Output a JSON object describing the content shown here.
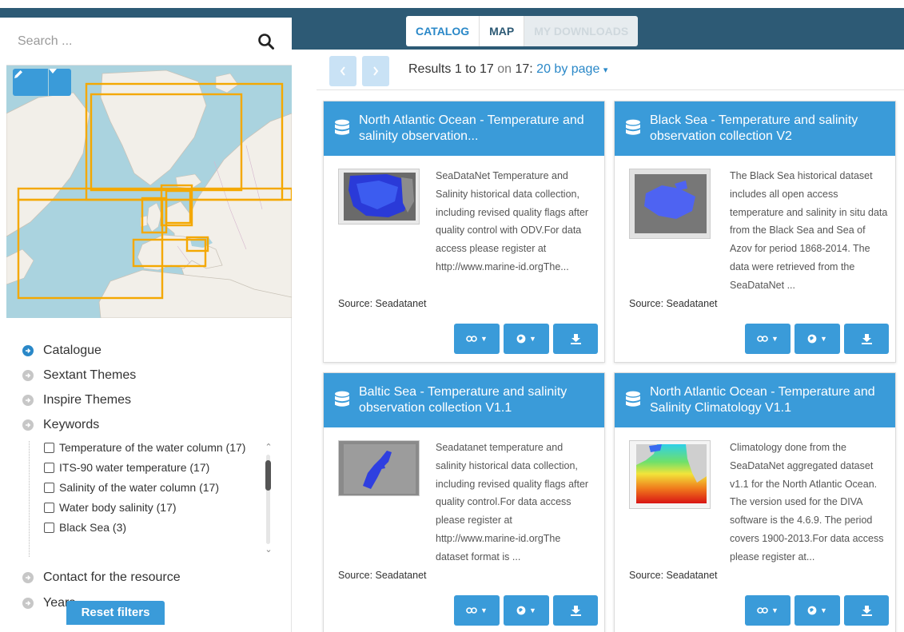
{
  "tabs": [
    {
      "label": "CATALOG"
    },
    {
      "label": "MAP"
    },
    {
      "label": "MY DOWNLOADS"
    }
  ],
  "search": {
    "placeholder": "Search ..."
  },
  "facets": {
    "items": [
      {
        "label": "Catalogue",
        "active": true
      },
      {
        "label": "Sextant Themes",
        "active": false
      },
      {
        "label": "Inspire Themes",
        "active": false
      },
      {
        "label": "Keywords",
        "active": false
      },
      {
        "label": "Contact for the resource",
        "active": false
      },
      {
        "label": "Years",
        "active": false
      }
    ],
    "keywords": [
      {
        "label": "Temperature of the water column (17)"
      },
      {
        "label": "ITS-90 water temperature (17)"
      },
      {
        "label": "Salinity of the water column (17)"
      },
      {
        "label": "Water body salinity (17)"
      },
      {
        "label": "Black Sea (3)"
      }
    ],
    "reset_label": "Reset filters"
  },
  "results": {
    "prefix": "Results",
    "from": "1",
    "to_word": "to",
    "to": "17",
    "on_word": "on",
    "total": "17",
    "sep": ":",
    "per_page": "20 by page"
  },
  "cards": [
    {
      "title": "North Atlantic Ocean - Temperature and salinity observation...",
      "abstract": "SeaDataNet Temperature and Salinity historical data collection, including revised quality flags after quality control with ODV.For data access please register at http://www.marine-id.orgThe...",
      "source": "Source: Seadatanet"
    },
    {
      "title": "Black Sea - Temperature and salinity observation collection V2",
      "abstract": "The Black Sea historical dataset includes all open access temperature and salinity in situ data from the Black Sea and Sea of Azov for period 1868-2014. The data were retrieved from the SeaDataNet ...",
      "source": "Source: Seadatanet"
    },
    {
      "title": "Baltic Sea - Temperature and salinity observation collection V1.1",
      "abstract": "Seadatanet temperature and salinity historical data collection, including revised quality flags after quality control.For data access please register at http://www.marine-id.orgThe dataset format is ...",
      "source": "Source: Seadatanet"
    },
    {
      "title": "North Atlantic Ocean - Temperature and Salinity Climatology V1.1",
      "abstract": "Climatology done from the SeaDataNet aggregated dataset v1.1 for the North Atlantic Ocean. The version used for the DIVA software is the 4.6.9. The period covers 1900-2013.For data access please register at...",
      "source": "Source: Seadatanet"
    }
  ],
  "colors": {
    "topbar": "#2d5a75",
    "accent": "#3a9bd9",
    "link": "#2a88c8",
    "bbox": "#f4a800"
  },
  "icons": [
    "search-icon",
    "pencil-icon",
    "caret-down-icon",
    "chevron-left-icon",
    "chevron-right-icon",
    "database-icon",
    "link-icon",
    "globe-icon",
    "download-icon"
  ]
}
